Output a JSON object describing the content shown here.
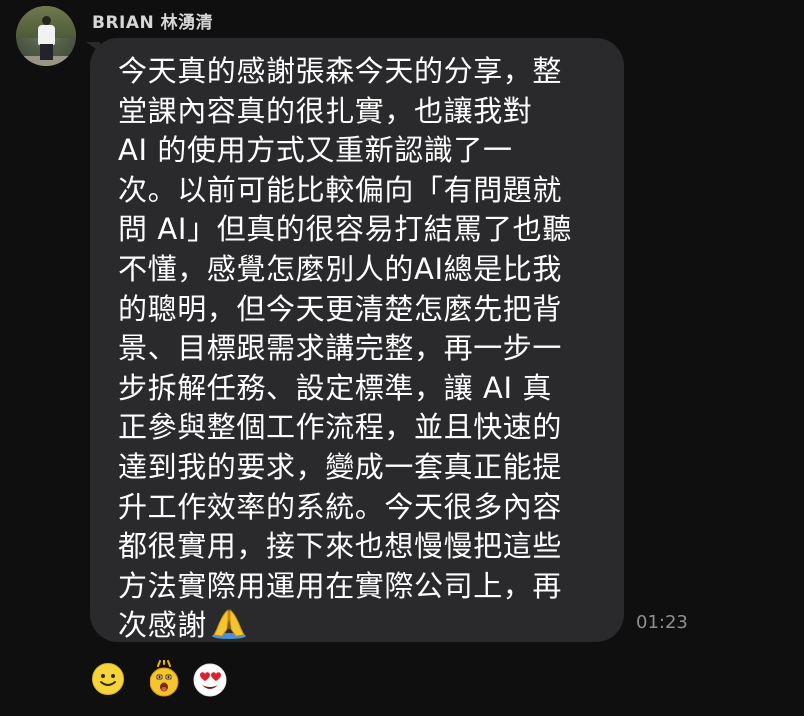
{
  "sender": {
    "name": "BRIAN 林湧清"
  },
  "message": {
    "lines": [
      "今天真的感謝張森今天的分享，整",
      "堂課內容真的很扎實，也讓我對",
      "AI 的使用方式又重新認識了一",
      "次。以前可能比較偏向「有問題就",
      "問 AI」但真的很容易打結罵了也聽",
      "不懂，感覺怎麼別人的AI總是比我",
      "的聰明，但今天更清楚怎麼先把背",
      "景、目標跟需求講完整，再一步一",
      "步拆解任務、設定標準，讓 AI 真",
      "正參與整個工作流程，並且快速的",
      "達到我的要求，變成一套真正能提",
      "升工作效率的系統。今天很多內容",
      "都很實用，接下來也想慢慢把這些",
      "方法實際用運用在實際公司上，再",
      "次感謝"
    ],
    "trailing_emoji": "folded-hands-icon",
    "time": "01:23"
  },
  "reactions": {
    "add_icon": "smiley-add-reaction-icon",
    "items": [
      "shocked-face-icon",
      "heart-eyes-icon"
    ]
  },
  "colors": {
    "background": "#0f0f10",
    "bubble": "#2a2a2c",
    "text": "#ffffff",
    "time": "#8e8e93",
    "smiley": "#f5d53b"
  }
}
